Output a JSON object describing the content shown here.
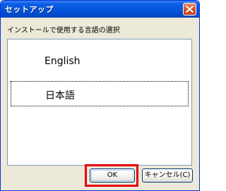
{
  "window": {
    "title": "セットアップ",
    "close_icon": "close-icon"
  },
  "instruction": "インストールで使用する言語の選択",
  "languages": [
    {
      "label": "English",
      "selected": false
    },
    {
      "label": "日本語",
      "selected": true
    }
  ],
  "buttons": {
    "ok": "OK",
    "cancel": "キャンセル(C)"
  },
  "colors": {
    "highlight": "#e60012",
    "titlebar": "#0453d8"
  }
}
